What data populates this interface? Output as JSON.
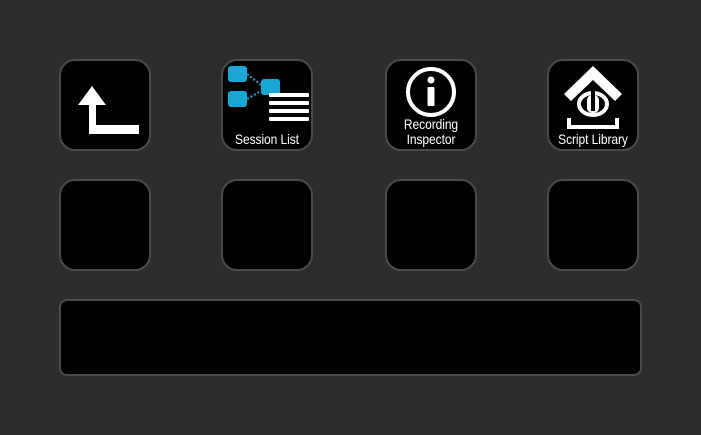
{
  "keys": {
    "back": {
      "label": "",
      "icon": "back-arrow-icon"
    },
    "session_list": {
      "label": "Session List",
      "icon": "session-list-icon",
      "accent": "#19a8d6"
    },
    "recording_inspector": {
      "label_line1": "Recording",
      "label_line2": "Inspector",
      "icon": "info-icon"
    },
    "script_library": {
      "label": "Script Library",
      "icon": "script-library-icon"
    }
  },
  "colors": {
    "background": "#2d2d2d",
    "key_face": "#000000",
    "key_border": "#4a4a4a",
    "accent": "#19a8d6"
  }
}
